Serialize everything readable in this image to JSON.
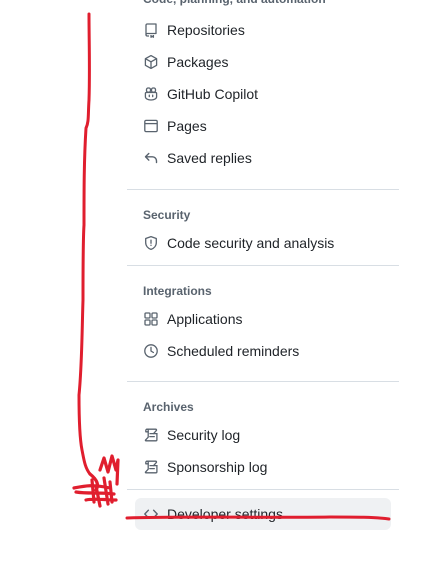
{
  "sections": {
    "code_planning_automation": {
      "heading": "Code, planning, and automation",
      "items": [
        {
          "label": "Repositories",
          "icon": "repo-icon"
        },
        {
          "label": "Packages",
          "icon": "package-icon"
        },
        {
          "label": "GitHub Copilot",
          "icon": "copilot-icon"
        },
        {
          "label": "Pages",
          "icon": "browser-icon"
        },
        {
          "label": "Saved replies",
          "icon": "reply-icon"
        }
      ]
    },
    "security": {
      "heading": "Security",
      "items": [
        {
          "label": "Code security and analysis",
          "icon": "shield-icon"
        }
      ]
    },
    "integrations": {
      "heading": "Integrations",
      "items": [
        {
          "label": "Applications",
          "icon": "apps-icon"
        },
        {
          "label": "Scheduled reminders",
          "icon": "clock-icon"
        }
      ]
    },
    "archives": {
      "heading": "Archives",
      "items": [
        {
          "label": "Security log",
          "icon": "log-icon"
        },
        {
          "label": "Sponsorship log",
          "icon": "log-icon"
        }
      ]
    },
    "developer": {
      "items": [
        {
          "label": "Developer settings",
          "icon": "code-icon",
          "active": true
        }
      ]
    }
  },
  "colors": {
    "annotation": "#e01e2e",
    "active_background": "#eff1f3",
    "heading": "#59636e",
    "divider": "#d8dee4"
  }
}
